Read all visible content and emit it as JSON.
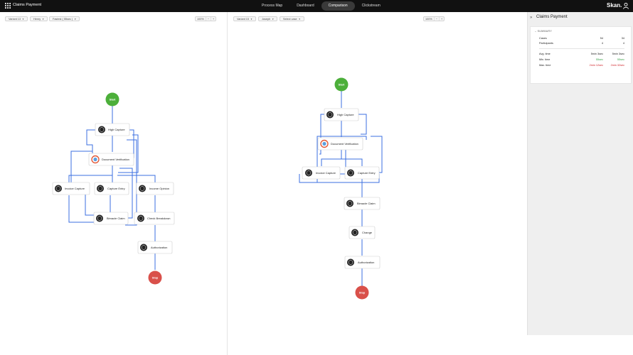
{
  "app": {
    "title": "Claims Payment",
    "brand": "Skan."
  },
  "nav": {
    "tabs": [
      {
        "label": "Process Map",
        "active": false
      },
      {
        "label": "Dashboard",
        "active": false
      },
      {
        "label": "Comparison",
        "active": true
      },
      {
        "label": "Clickstream",
        "active": false
      }
    ]
  },
  "left_panel": {
    "filters": {
      "variant": "Variant 13",
      "user": "Henry",
      "speed": "Fastest ( 55sec )"
    },
    "zoom": {
      "level": "100%",
      "minus": "−",
      "plus": "+"
    },
    "map": {
      "start": "Start",
      "stop": "Stop",
      "nodes": [
        "High Capture",
        "Document Verification",
        "Invoice Capture",
        "Capture Entry",
        "Income Opinion",
        "Bimacle Claim",
        "Check Breakdown",
        "Authorization"
      ]
    }
  },
  "right_panel": {
    "filters": {
      "variant": "Variant 15",
      "user": "Joseph",
      "select": "Select case"
    },
    "zoom": {
      "level": "100%",
      "minus": "−",
      "plus": "+"
    },
    "map": {
      "start": "Start",
      "stop": "Stop",
      "nodes": [
        "High Capture",
        "Document Verification",
        "Invoice Capture",
        "Capture Entry",
        "Bimacle Claim",
        "Change",
        "Authorization"
      ]
    }
  },
  "sidebar": {
    "title": "Claims Payment",
    "summary_label": "SUMMARY",
    "rows": {
      "cases": {
        "label": "Cases",
        "a": "54",
        "b": "34"
      },
      "participants": {
        "label": "Participants",
        "a": "4",
        "b": "4"
      },
      "avg": {
        "label": "Avg. time",
        "a": "5min 3sec",
        "b": "5min 3sec"
      },
      "min": {
        "label": "Min. time",
        "a": "55sec",
        "b": "55sec"
      },
      "max": {
        "label": "Max. time",
        "a": "2min 12sec",
        "b": "2min 32sec"
      }
    }
  },
  "colors": {
    "edge": "#3b6fe0",
    "start": "#4caf3a",
    "stop": "#d9504a",
    "min_time": "#3aa14a",
    "max_time": "#d0262c"
  }
}
